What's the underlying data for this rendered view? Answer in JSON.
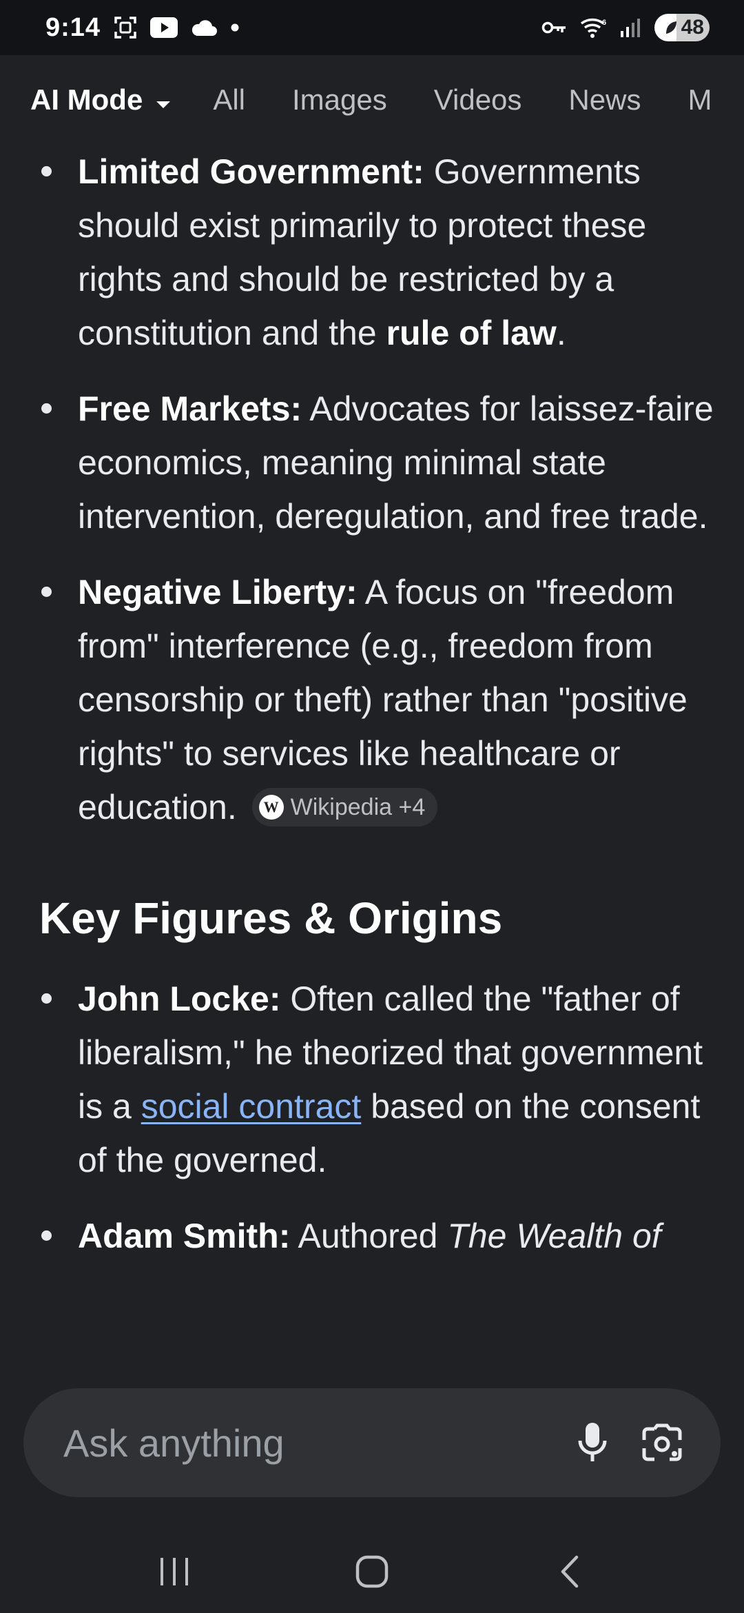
{
  "status": {
    "time": "9:14",
    "battery": "48"
  },
  "tabs": [
    {
      "label": "AI Mode"
    },
    {
      "label": "All"
    },
    {
      "label": "Images"
    },
    {
      "label": "Videos"
    },
    {
      "label": "News"
    },
    {
      "label": "M"
    }
  ],
  "content": {
    "items": [
      {
        "term": "Limited Government:",
        "text_1": " Governments should exist primarily to protect these rights and should be restricted by a constitution and the ",
        "bold_2": "rule of law",
        "text_2": "."
      },
      {
        "term": "Free Markets:",
        "text_1": " Advocates for laissez-faire economics, meaning minimal state intervention, deregulation, and free trade."
      },
      {
        "term": "Negative Liberty:",
        "text_1": " A focus on \"freedom from\" interference (e.g., freedom from censorship or theft) rather than \"positive rights\" to services like healthcare or education.",
        "source": "Wikipedia +4"
      }
    ],
    "section_heading": "Key Figures & Origins",
    "figures": [
      {
        "term": "John Locke:",
        "text_1": " Often called the \"father of liberalism,\" he theorized that government is a ",
        "link": "social contract",
        "text_2": " based on the consent of the governed."
      },
      {
        "term": "Adam Smith:",
        "text_1": " Authored ",
        "italic": "The Wealth of"
      }
    ]
  },
  "ask": {
    "placeholder": "Ask anything"
  },
  "icons": {
    "status_left": [
      "screenshot-icon",
      "youtube-icon",
      "cloud-icon",
      "dot-icon"
    ],
    "status_right": [
      "key-icon",
      "wifi-icon",
      "signal-icon",
      "battery-icon"
    ],
    "ask": [
      "microphone-icon",
      "google-lens-icon"
    ],
    "nav": [
      "recents-icon",
      "home-icon",
      "back-icon"
    ]
  }
}
